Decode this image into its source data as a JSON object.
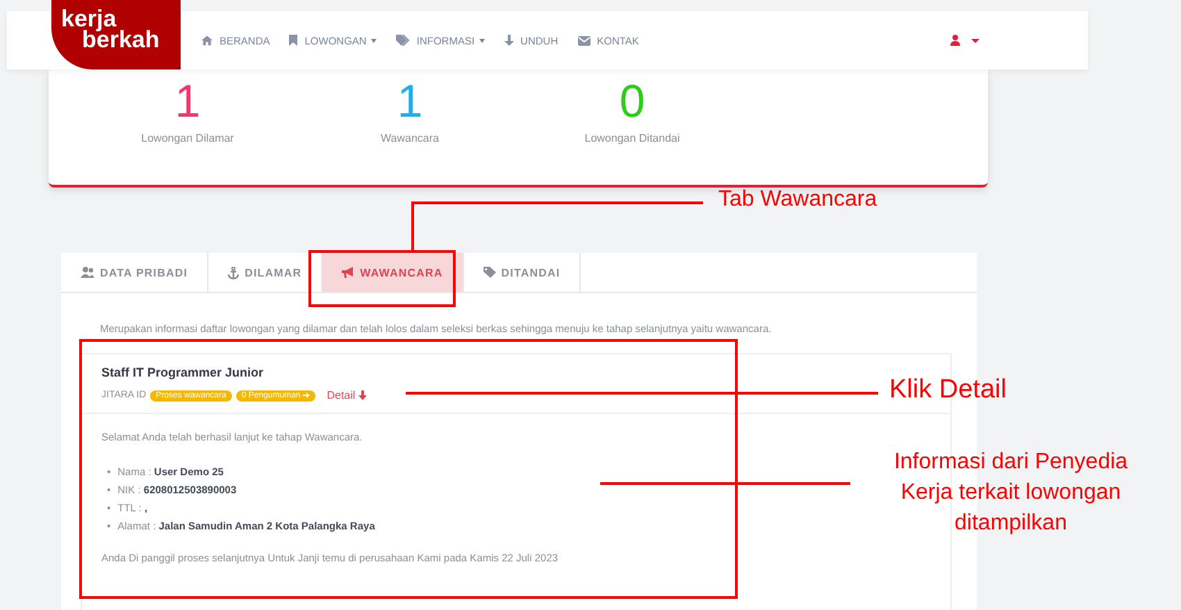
{
  "navbar": {
    "logo": [
      "kerja",
      "berkah"
    ],
    "menu": [
      {
        "label": "BERANDA",
        "dropdown": false
      },
      {
        "label": "LOWONGAN",
        "dropdown": true
      },
      {
        "label": "INFORMASI",
        "dropdown": true
      },
      {
        "label": "UNDUH",
        "dropdown": false
      },
      {
        "label": "KONTAK",
        "dropdown": false
      }
    ]
  },
  "stats": [
    {
      "value": "1",
      "label": "Lowongan Dilamar",
      "color": "#f5366b"
    },
    {
      "value": "1",
      "label": "Wawancara",
      "color": "#1ab0f0"
    },
    {
      "value": "0",
      "label": "Lowongan Ditandai",
      "color": "#2ecc1a"
    }
  ],
  "tabs": [
    {
      "label": "DATA PRIBADI",
      "selected": false
    },
    {
      "label": "DILAMAR",
      "selected": false
    },
    {
      "label": "WAWANCARA",
      "selected": true
    },
    {
      "label": "DITANDAI",
      "selected": false
    }
  ],
  "description": "Merupakan informasi daftar lowongan yang dilamar dan telah lolos dalam seleksi berkas sehingga menuju ke tahap selanjutnya yaitu wawancara.",
  "job": {
    "title": "Staff IT Programmer Junior",
    "id_label": "JITARA ID",
    "badges": [
      {
        "text": "Proses wawancara",
        "arrow": false
      },
      {
        "text": "0 Pengumuman",
        "arrow": true
      }
    ],
    "detail_link": "Detail",
    "message": "Selamat Anda telah berhasil lanjut ke tahap Wawancara.",
    "details": [
      {
        "marker": "•",
        "label": "Nama :",
        "value": "User Demo 25"
      },
      {
        "marker": "•",
        "label": "NIK :",
        "value": "6208012503890003"
      },
      {
        "marker": "•",
        "label": "TTL :",
        "value": ","
      },
      {
        "marker": "•",
        "label": "Alamat :",
        "value": "Jalan Samudin Aman 2 Kota Palangka Raya"
      }
    ],
    "note": "Anda Di panggil proses selanjutnya Untuk Janji temu di perusahaan Kami pada Kamis 22 Juli 2023"
  },
  "annotations": [
    {
      "text": "Tab Wawancara"
    },
    {
      "text": "Klik Detail"
    },
    {
      "text": "Informasi dari Penyedia Kerja terkait lowongan ditampilkan"
    }
  ]
}
